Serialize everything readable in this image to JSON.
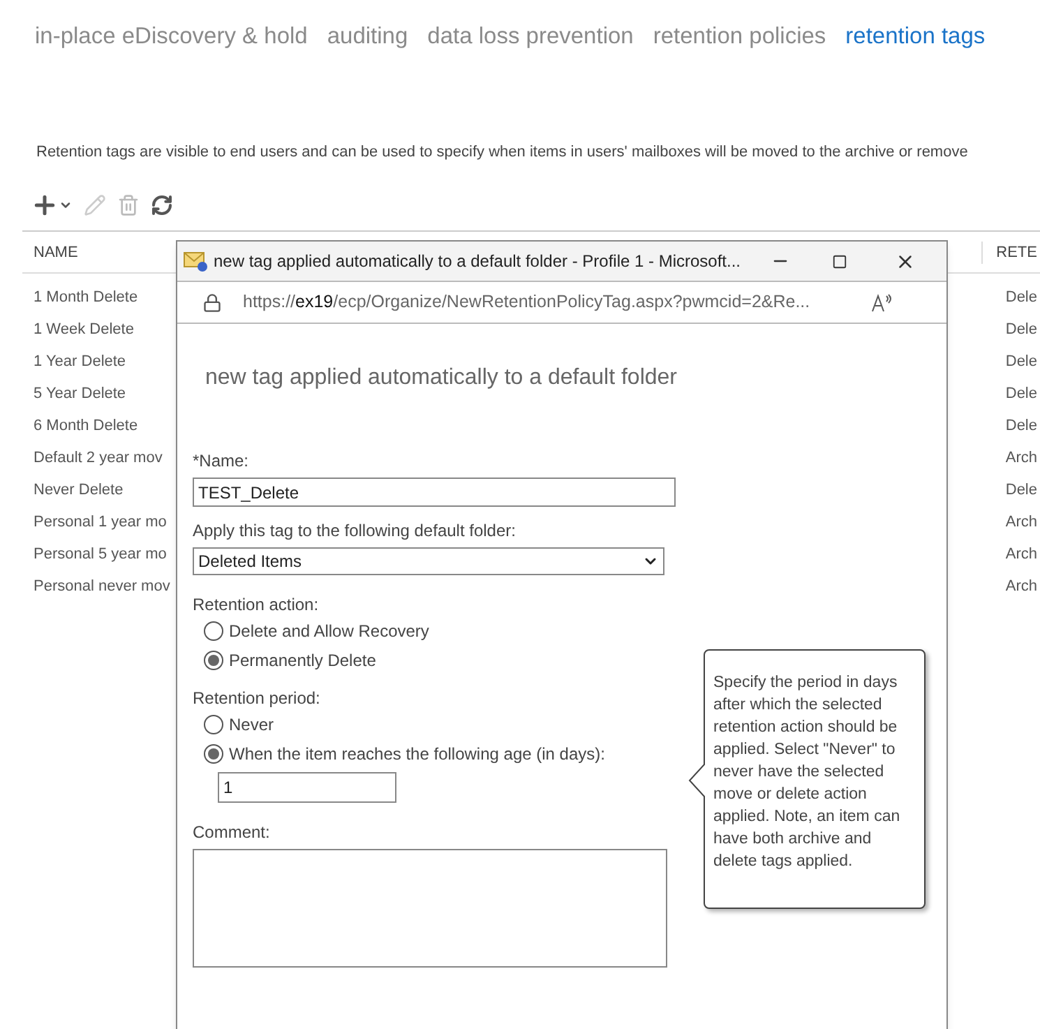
{
  "tabs": [
    {
      "label": "in-place eDiscovery & hold",
      "selected": false
    },
    {
      "label": "auditing",
      "selected": false
    },
    {
      "label": "data loss prevention",
      "selected": false
    },
    {
      "label": "retention policies",
      "selected": false
    },
    {
      "label": "retention tags",
      "selected": true
    }
  ],
  "description": "Retention tags are visible to end users and can be used to specify when items in users' mailboxes will be moved to the archive or remove",
  "table": {
    "columns": [
      "NAME",
      "RETE"
    ],
    "rows": [
      {
        "name": "1 Month Delete",
        "column_2": "Dele"
      },
      {
        "name": "1 Week Delete",
        "column_2": "Dele"
      },
      {
        "name": "1 Year Delete",
        "column_2": "Dele"
      },
      {
        "name": "5 Year Delete",
        "column_2": "Dele"
      },
      {
        "name": "6 Month Delete",
        "column_2": "Dele"
      },
      {
        "name": "Default 2 year mov",
        "column_2": "Arch"
      },
      {
        "name": "Never Delete",
        "column_2": "Dele"
      },
      {
        "name": "Personal 1 year mo",
        "column_2": "Arch"
      },
      {
        "name": "Personal 5 year mo",
        "column_2": "Arch"
      },
      {
        "name": "Personal never mov",
        "column_2": "Arch"
      }
    ]
  },
  "popup": {
    "title": "new tag applied automatically to a default folder - Profile 1 - Microsoft...",
    "url_scheme": "https://",
    "url_host": "ex19",
    "url_path": "/ecp/Organize/NewRetentionPolicyTag.aspx?pwmcid=2&Re...",
    "heading": "new tag applied automatically to a default folder",
    "name_label": "*Name:",
    "name_value": "TEST_Delete",
    "folder_label": "Apply this tag to the following default folder:",
    "folder_value": "Deleted Items",
    "retention_action": {
      "label": "Retention action:",
      "options": [
        {
          "label": "Delete and Allow Recovery",
          "selected": false
        },
        {
          "label": "Permanently Delete",
          "selected": true
        }
      ]
    },
    "retention_period": {
      "label": "Retention period:",
      "options": [
        {
          "label": "Never",
          "selected": false
        },
        {
          "label": "When the item reaches the following age (in days):",
          "selected": true
        }
      ]
    },
    "age_value": "1",
    "comment_label": "Comment:",
    "tooltip": "Specify the period in days after which the selected retention action should be applied. Select \"Never\" to never have the selected move or delete action applied. Note, an item can have both archive and delete tags applied."
  }
}
